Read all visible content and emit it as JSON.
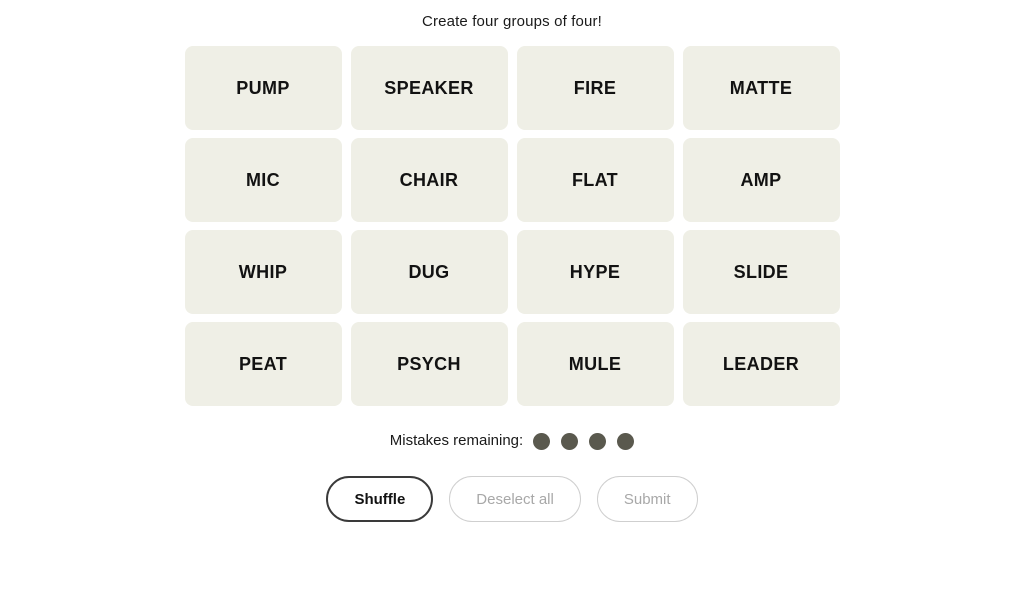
{
  "headline": "Create four groups of four!",
  "board": {
    "rows": [
      [
        "PUMP",
        "SPEAKER",
        "FIRE",
        "MATTE"
      ],
      [
        "MIC",
        "CHAIR",
        "FLAT",
        "AMP"
      ],
      [
        "WHIP",
        "DUG",
        "HYPE",
        "SLIDE"
      ],
      [
        "PEAT",
        "PSYCH",
        "MULE",
        "LEADER"
      ]
    ],
    "tile_color": "#efefe6",
    "tile_text_color": "#121212"
  },
  "mistakes": {
    "label": "Mistakes remaining:",
    "remaining": 4,
    "dot_color": "#5a594e"
  },
  "controls": {
    "shuffle_label": "Shuffle",
    "deselect_label": "Deselect all",
    "submit_label": "Submit",
    "shuffle_enabled": true,
    "deselect_enabled": false,
    "submit_enabled": false,
    "active_border_color": "#3a3a3a",
    "disabled_border_color": "#cfcfcf",
    "disabled_text_color": "#a8a8a8"
  }
}
